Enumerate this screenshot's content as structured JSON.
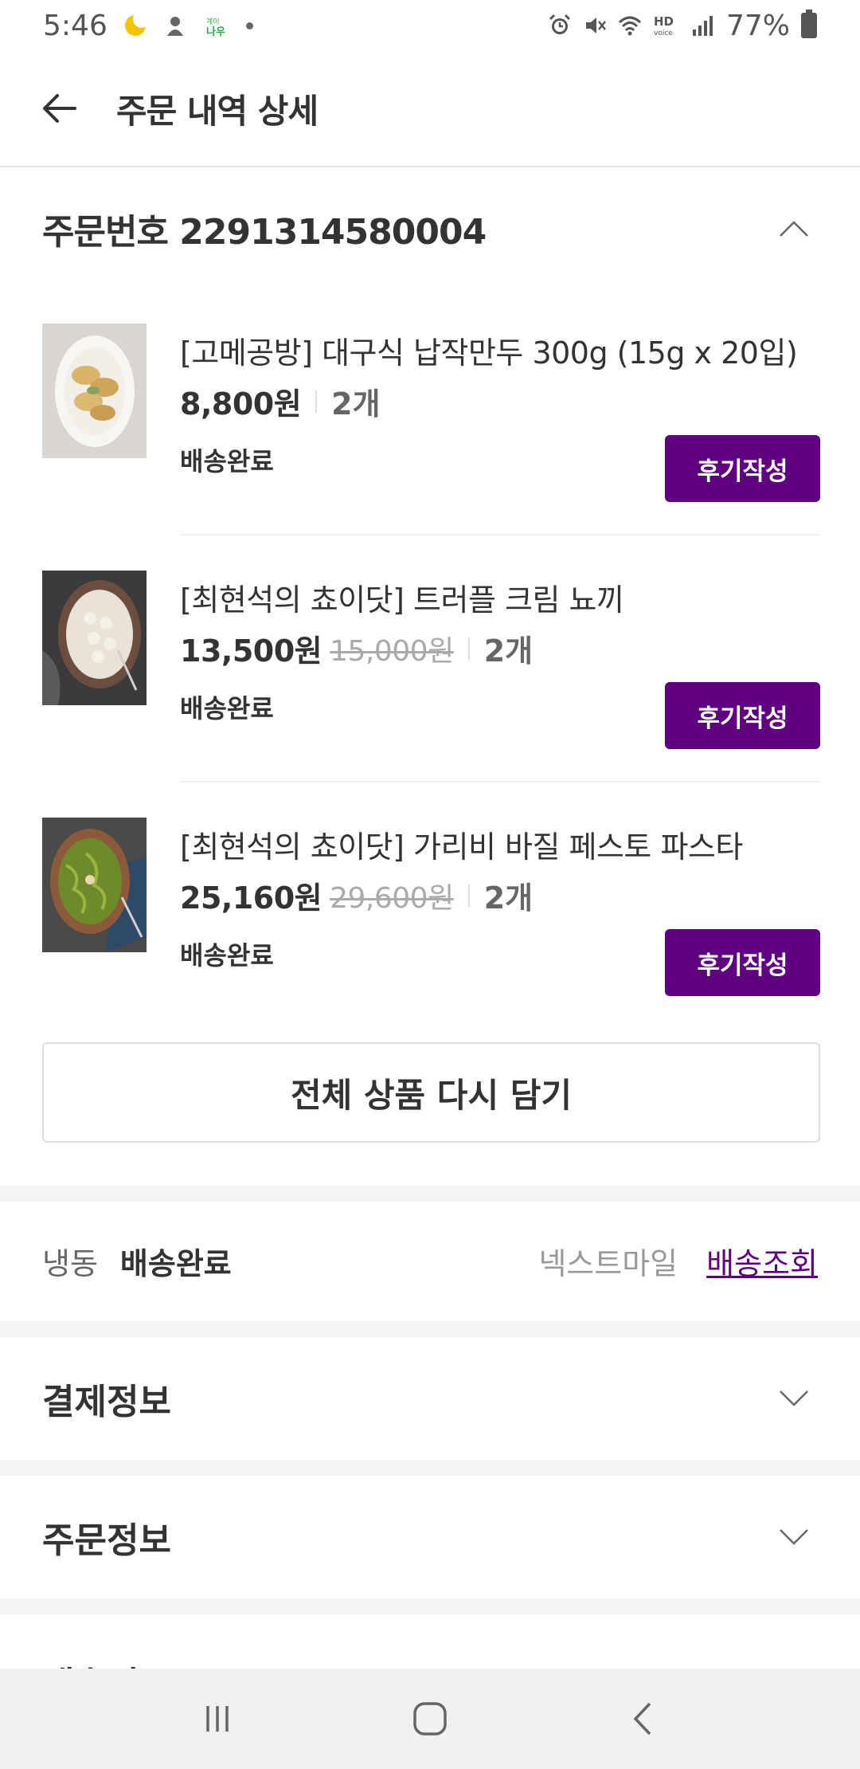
{
  "status_bar": {
    "time": "5:46",
    "battery": "77%",
    "icons": [
      "moon-icon",
      "app-icon",
      "naver-app-icon",
      "notification-dot",
      "alarm-icon",
      "mute-icon",
      "wifi-icon",
      "hd-voice-icon",
      "signal-icon",
      "battery-icon"
    ]
  },
  "header": {
    "title": "주문 내역 상세",
    "back_icon": "arrow-left-icon"
  },
  "order": {
    "number_label": "주문번호 2291314580004",
    "toggle_icon": "chevron-up-icon"
  },
  "products": [
    {
      "name": "[고메공방] 대구식 납작만두 300g (15g x 20입)",
      "price": "8,800원",
      "original_price": "",
      "quantity": "2개",
      "status": "배송완료",
      "review_label": "후기작성"
    },
    {
      "name": "[최현석의 쵸이닷] 트러플 크림 뇨끼",
      "price": "13,500원",
      "original_price": "15,000원",
      "quantity": "2개",
      "status": "배송완료",
      "review_label": "후기작성"
    },
    {
      "name": "[최현석의 쵸이닷] 가리비 바질 페스토 파스타",
      "price": "25,160원",
      "original_price": "29,600원",
      "quantity": "2개",
      "status": "배송완료",
      "review_label": "후기작성"
    }
  ],
  "readd_all_label": "전체 상품 다시 담기",
  "delivery": {
    "type": "냉동",
    "status": "배송완료",
    "carrier": "넥스트마일",
    "track_label": "배송조회"
  },
  "sections": {
    "payment": "결제정보",
    "order_info": "주문정보",
    "shipping": "배송정보"
  },
  "colors": {
    "accent": "#5f0080",
    "text": "#333333",
    "muted": "#999999",
    "divider": "#eeeeee"
  }
}
